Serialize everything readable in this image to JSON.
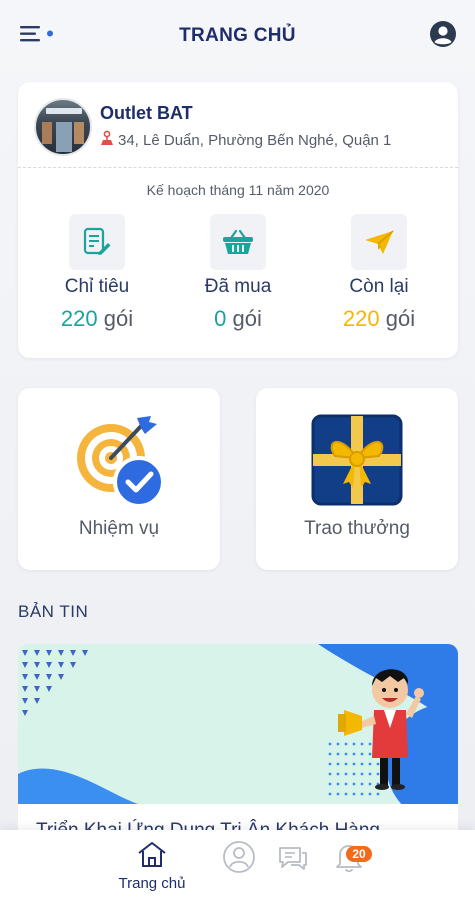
{
  "header": {
    "title": "TRANG CHỦ",
    "menu_icon": "menu-dot-icon",
    "profile_icon": "account-circle-icon"
  },
  "outlet": {
    "name": "Outlet BAT",
    "address": "34, Lê Duẩn, Phường Bến Nghé, Quận 1",
    "plan_title": "Kế hoạch tháng 11 năm 2020",
    "stats": [
      {
        "label": "Chỉ tiêu",
        "value": "220",
        "unit": "gói",
        "icon": "document-edit-icon",
        "color": "#1ba39c"
      },
      {
        "label": "Đã mua",
        "value": "0",
        "unit": "gói",
        "icon": "shopping-basket-icon",
        "color": "#1ba39c"
      },
      {
        "label": "Còn lại",
        "value": "220",
        "unit": "gói",
        "icon": "paper-plane-icon",
        "color": "#f5b800"
      }
    ]
  },
  "tiles": {
    "missions_label": "Nhiệm vụ",
    "rewards_label": "Trao thưởng"
  },
  "news": {
    "section_title": "BẢN TIN",
    "items": [
      {
        "title": "Triển Khai Ứng Dụng Tri Ân Khách Hàng"
      }
    ]
  },
  "bottom_nav": {
    "home_label": "Trang chủ",
    "notification_count": "20"
  },
  "colors": {
    "primary": "#1f2d6b",
    "teal": "#1ba39c",
    "yellow": "#f5b800",
    "badge": "#f26b1d"
  }
}
